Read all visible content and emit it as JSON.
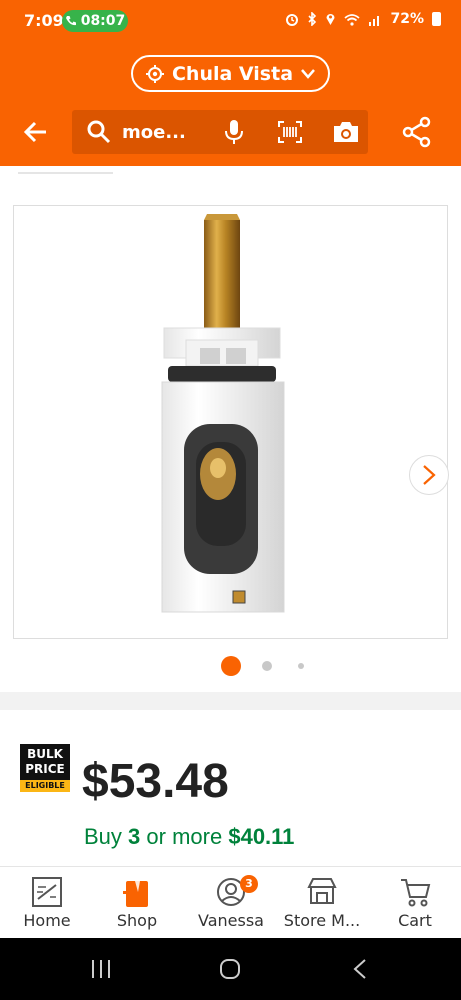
{
  "status_bar": {
    "time": "7:09",
    "call_time": "08:07",
    "battery": "72%"
  },
  "header": {
    "location": "Chula Vista",
    "search_text": "moe...",
    "icons": [
      "back-arrow-icon",
      "search-icon",
      "microphone-icon",
      "barcode-icon",
      "camera-icon",
      "share-icon"
    ]
  },
  "gallery": {
    "total_images": 3,
    "active_index": 0,
    "accent": "#f96302"
  },
  "price": {
    "badge_line1": "BULK",
    "badge_line2": "PRICE",
    "badge_line3": "ELIGIBLE",
    "amount": "$53.48",
    "bulk_prefix": "Buy",
    "bulk_qty": "3",
    "bulk_mid": "or more",
    "bulk_price": "$40.11",
    "bulk_color": "#00823b"
  },
  "bottom_nav": {
    "items": [
      {
        "label": "Home",
        "icon": "home-depot-logo-icon"
      },
      {
        "label": "Shop",
        "icon": "shop-icon"
      },
      {
        "label": "Vanessa",
        "icon": "account-icon",
        "badge": "3"
      },
      {
        "label": "Store M...",
        "icon": "store-icon"
      },
      {
        "label": "Cart",
        "icon": "cart-icon"
      }
    ]
  },
  "colors": {
    "brand": "#f96302",
    "search_bg": "#db5500"
  }
}
